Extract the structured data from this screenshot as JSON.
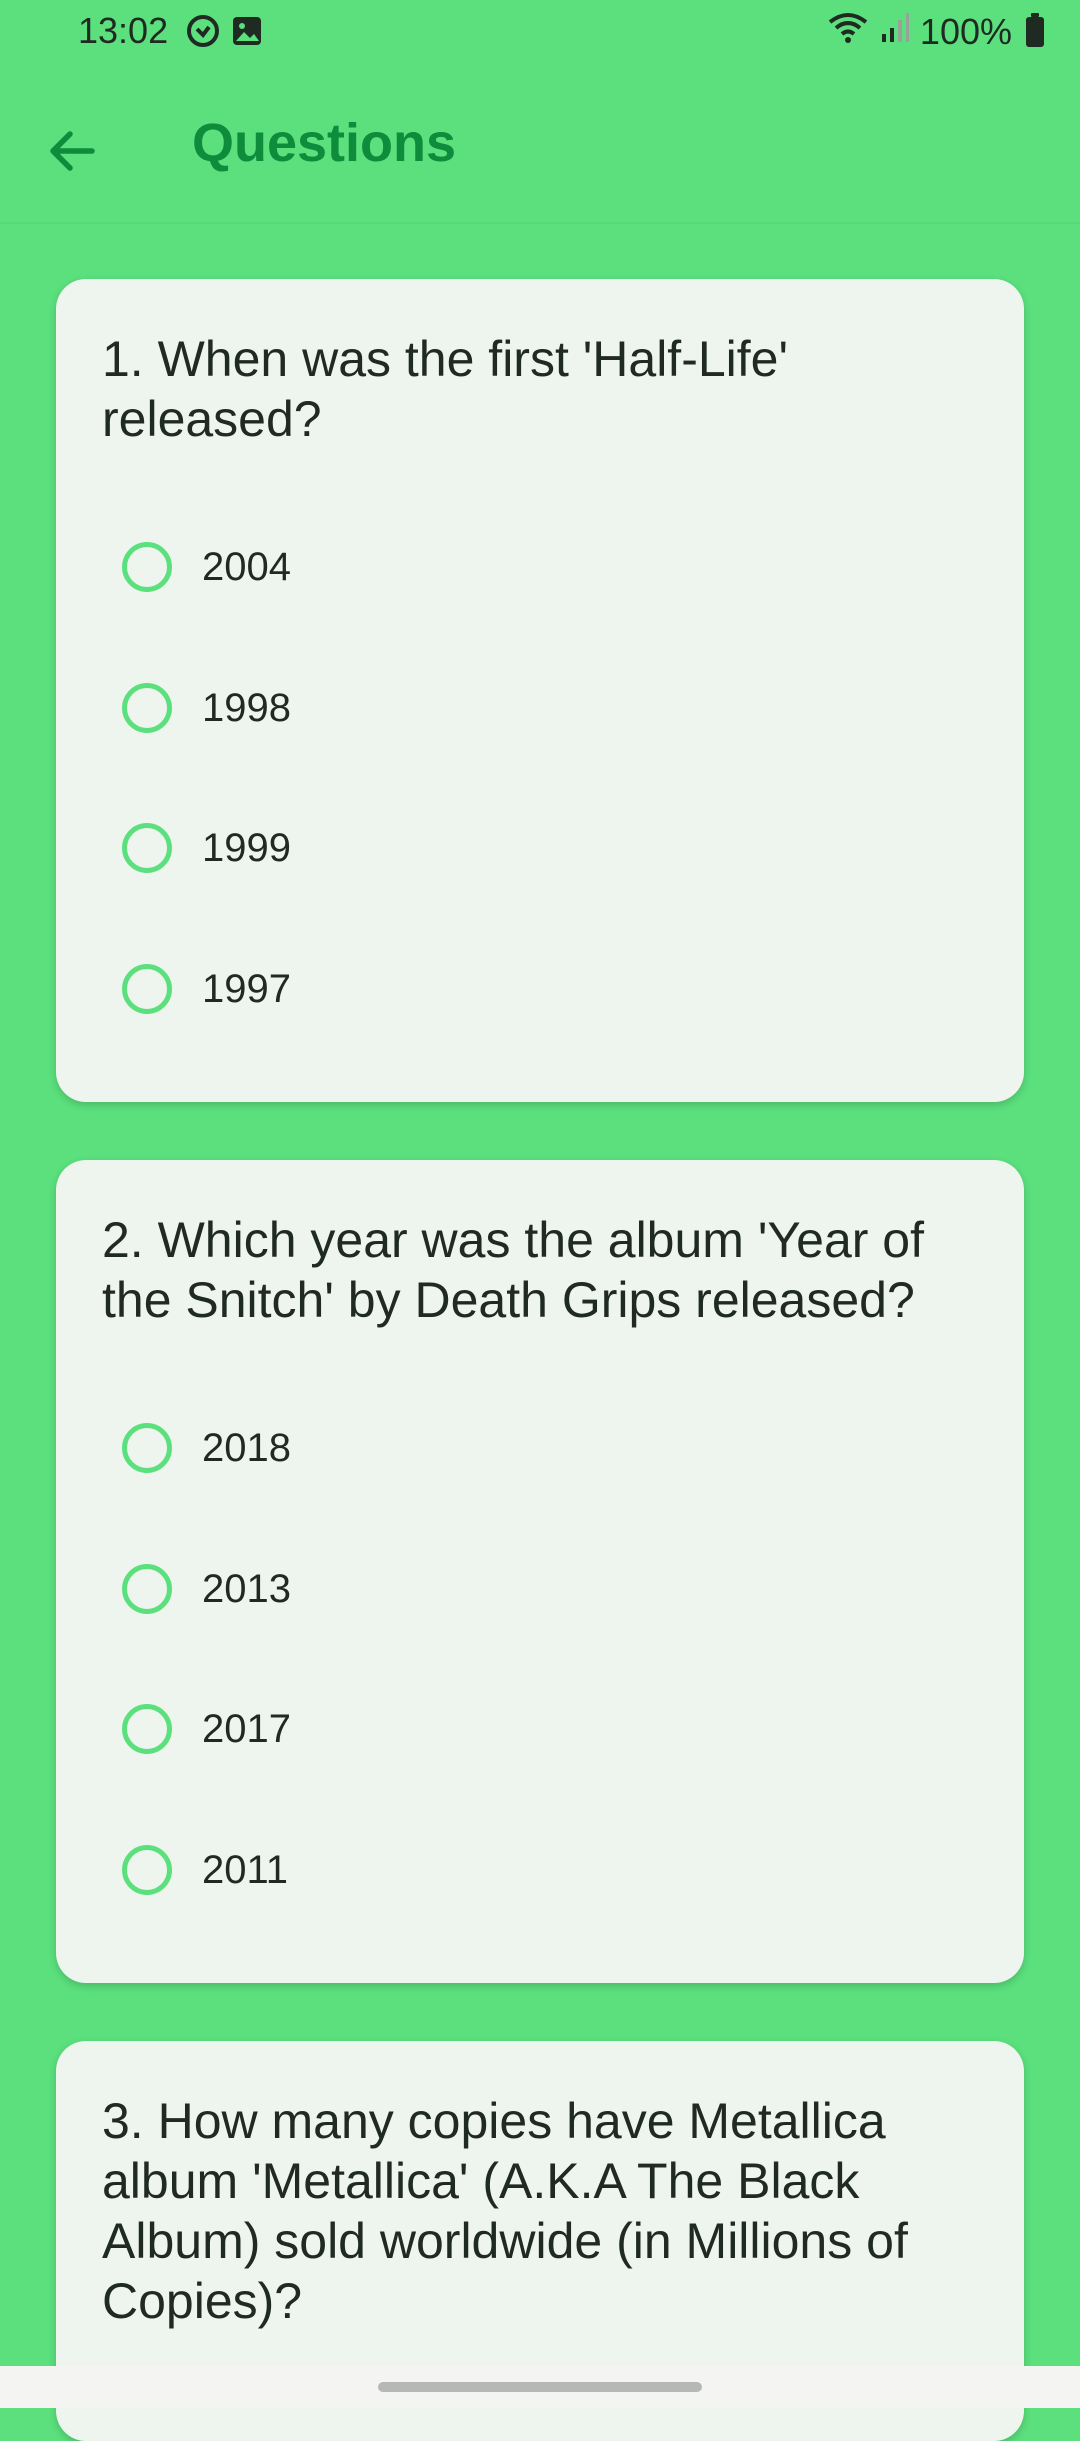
{
  "status_bar": {
    "time": "13:02",
    "battery": "100%"
  },
  "app_bar": {
    "title": "Questions"
  },
  "colors": {
    "background": "#5BE07D",
    "card": "#EEF5EE",
    "title": "#0E8B3B",
    "radio": "#5BE07D"
  },
  "questions": [
    {
      "text": "1. When was the first 'Half-Life' released?",
      "options": [
        "2004",
        "1998",
        "1999",
        "1997"
      ]
    },
    {
      "text": "2. Which year was the album 'Year of the Snitch' by Death Grips released?",
      "options": [
        "2018",
        "2013",
        "2017",
        "2011"
      ]
    },
    {
      "text": "3. How many copies have Metallica album 'Metallica' (A.K.A The Black Album) sold worldwide (in Millions of Copies)?",
      "options": []
    }
  ]
}
